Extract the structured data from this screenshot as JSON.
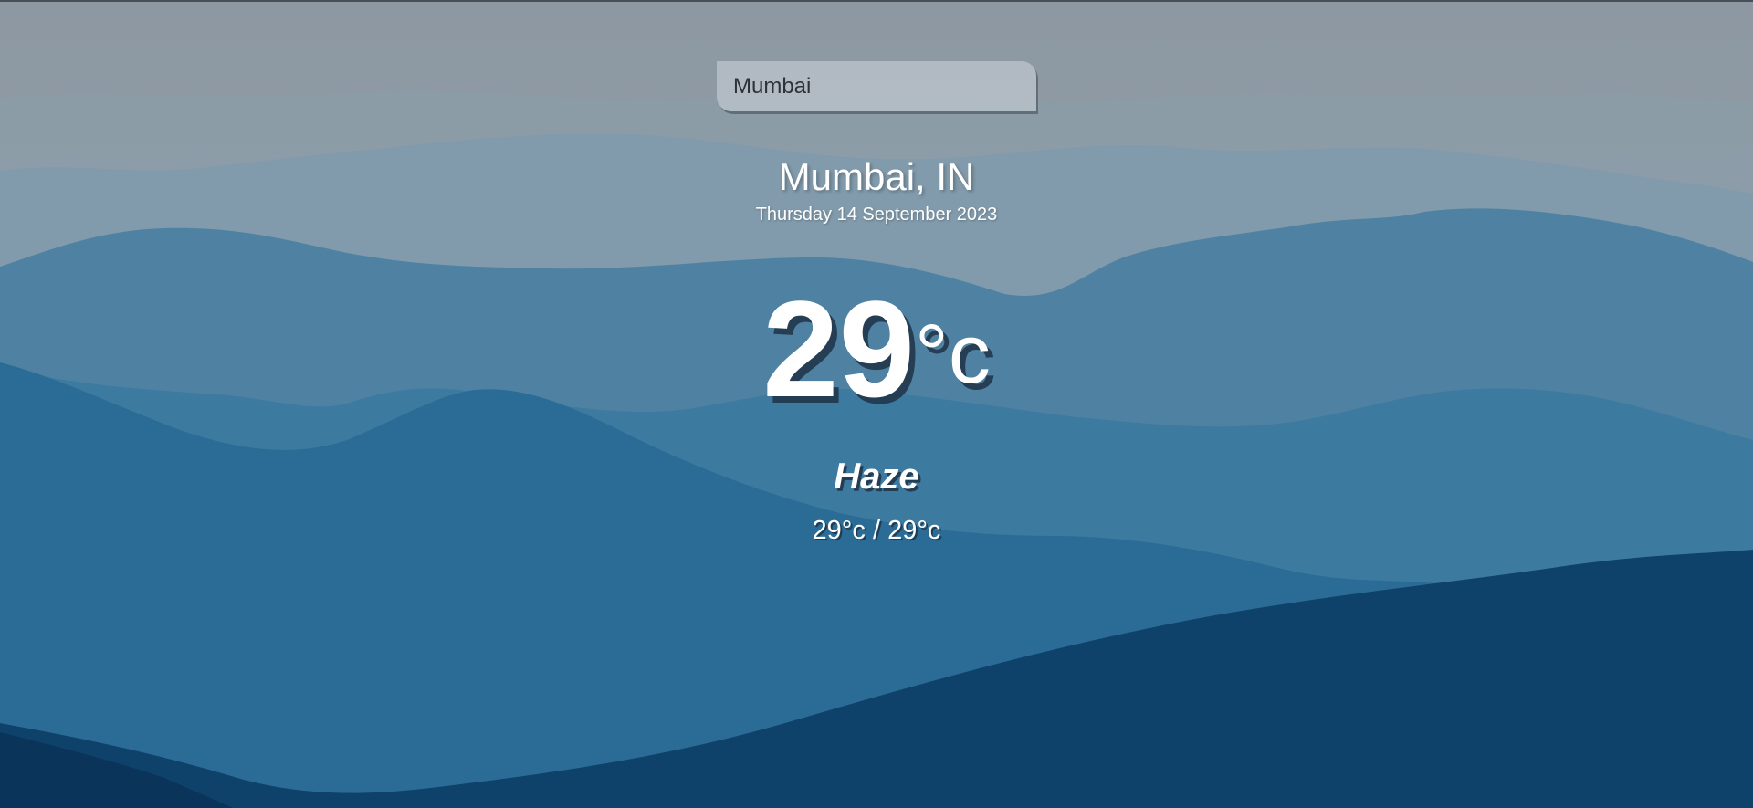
{
  "search": {
    "value": "Mumbai"
  },
  "weather": {
    "location": "Mumbai, IN",
    "date": "Thursday 14 September 2023",
    "temperature": "29",
    "unit": "°c",
    "condition": "Haze",
    "hi_lo": "29°c / 29°c"
  },
  "colors": {
    "sky": "#8e9ba6",
    "far_hills": "#7f9cae",
    "mid_hills": "#4d82a3",
    "near_hills": "#2a6e99",
    "front_hills": "#0d3f66",
    "text": "#ffffff"
  }
}
